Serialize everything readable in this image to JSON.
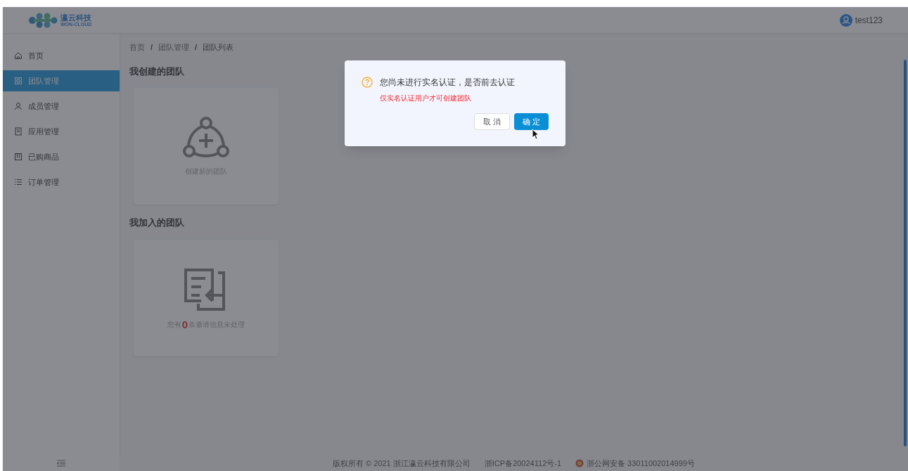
{
  "header": {
    "logo_title": "瀛云科技",
    "logo_subtitle": "WON-CLOUD",
    "user": "test123"
  },
  "sidebar": {
    "items": [
      {
        "label": "首页",
        "selected": false
      },
      {
        "label": "团队管理",
        "selected": true
      },
      {
        "label": "成员管理",
        "selected": false
      },
      {
        "label": "应用管理",
        "selected": false
      },
      {
        "label": "已购商品",
        "selected": false
      },
      {
        "label": "订单管理",
        "selected": false
      }
    ]
  },
  "breadcrumb": {
    "items": [
      "首页",
      "团队管理",
      "团队列表"
    ],
    "separators": [
      "/",
      "/"
    ]
  },
  "sections": [
    {
      "title": "我创建的团队",
      "card": {
        "kind": "create",
        "text": "创建新的团队"
      }
    },
    {
      "title": "我加入的团队",
      "card": {
        "kind": "invite",
        "before": "您有",
        "count": "0",
        "after": "条邀请信息未处理"
      }
    }
  ],
  "footer": {
    "copyright": "版权所有 © 2021 浙江瀛云科技有限公司",
    "icp": "浙ICP备20024112号-1",
    "police": "浙公网安备 33011002014999号"
  },
  "dialog": {
    "title": "您尚未进行实名认证，是否前去认证",
    "message": "仅实名认证用户才可创建团队",
    "buttons": [
      {
        "label": "取 消",
        "primary": false
      },
      {
        "label": "确 定",
        "primary": true
      }
    ]
  }
}
